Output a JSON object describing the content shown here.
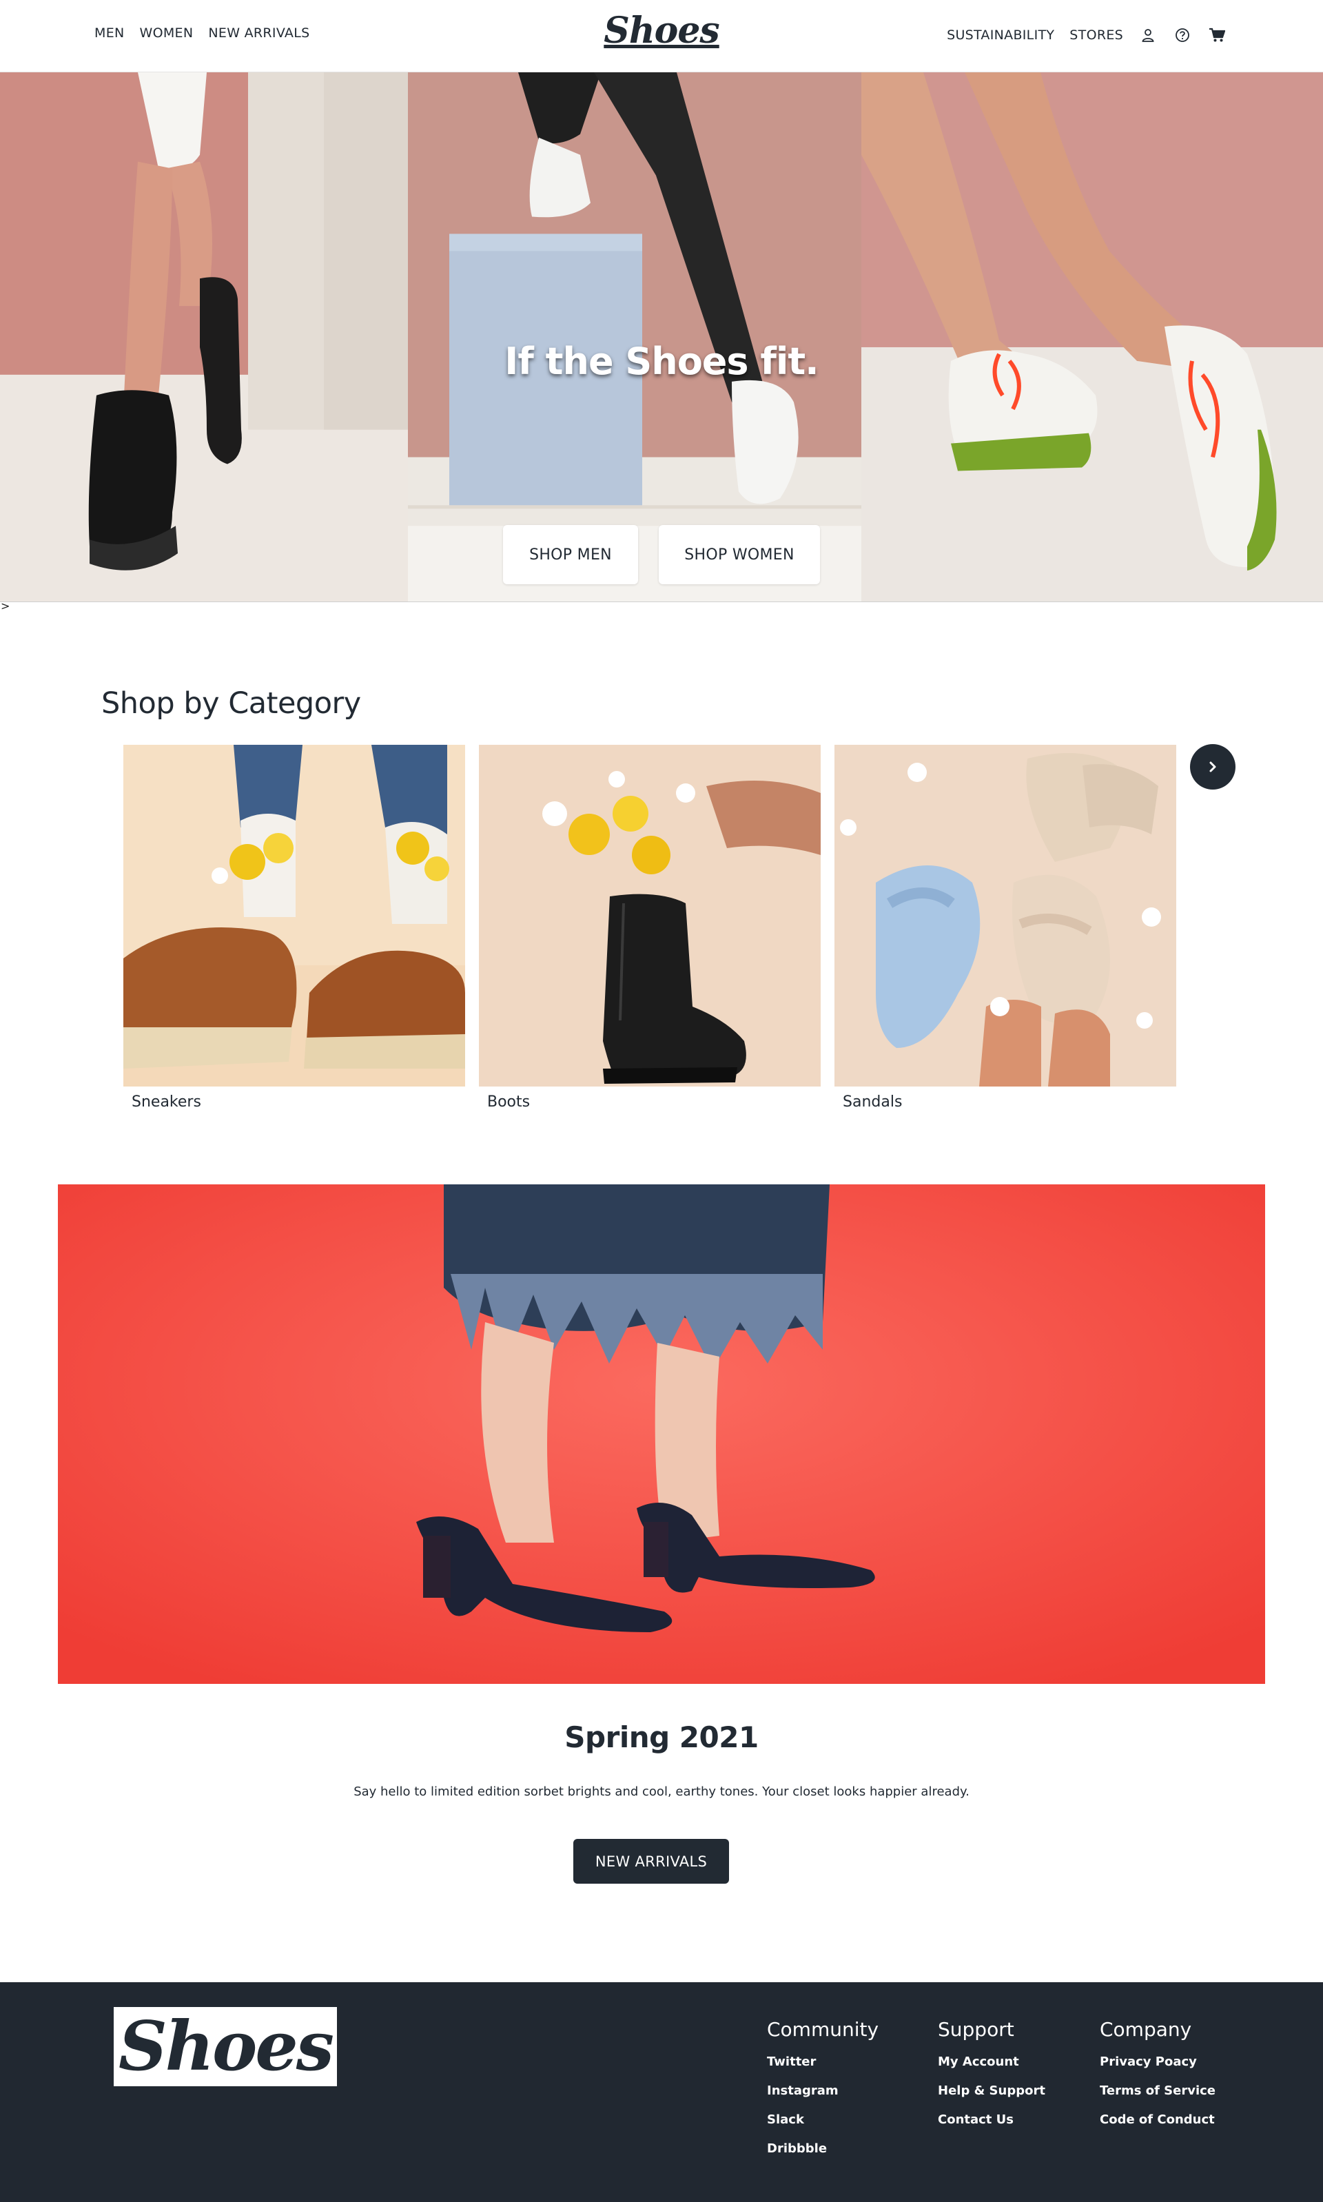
{
  "header": {
    "brand": "Shoes",
    "nav_left": [
      "MEN",
      "WOMEN",
      "NEW ARRIVALS"
    ],
    "nav_right": [
      "SUSTAINABILITY",
      "STORES"
    ],
    "icons": [
      "user-icon",
      "help-icon",
      "cart-icon"
    ]
  },
  "hero": {
    "title": "If the Shoes fit.",
    "shop_men": "SHOP MEN",
    "shop_women": "SHOP WOMEN",
    "caret": ">"
  },
  "category": {
    "title": "Shop by Category",
    "items": [
      {
        "label": "Sneakers"
      },
      {
        "label": "Boots"
      },
      {
        "label": "Sandals"
      }
    ],
    "next_icon": "chevron-right-icon"
  },
  "feature": {
    "title": "Spring 2021",
    "text": "Say hello to limited edition sorbet brights and cool, earthy tones. Your closet looks happier already.",
    "button": "NEW ARRIVALS"
  },
  "footer": {
    "logo": "Shoes",
    "columns": [
      {
        "heading": "Community",
        "links": [
          "Twitter",
          "Instagram",
          "Slack",
          "Dribbble"
        ]
      },
      {
        "heading": "Support",
        "links": [
          "My Account",
          "Help & Support",
          "Contact Us"
        ]
      },
      {
        "heading": "Company",
        "links": [
          "Privacy Poacy",
          "Terms of Service",
          "Code of Conduct"
        ]
      }
    ]
  },
  "colors": {
    "dark": "#222a33",
    "footer_bg": "#212831",
    "hero_pink": "#c98d84",
    "feature_red": "#f2453c"
  }
}
